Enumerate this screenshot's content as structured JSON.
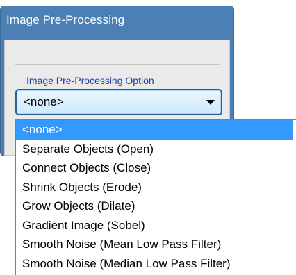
{
  "panel": {
    "title": "Image Pre-Processing"
  },
  "group": {
    "label": "Image Pre-Processing Option"
  },
  "combo": {
    "selected_value": "<none>"
  },
  "dropdown": {
    "items": [
      "<none>",
      "Separate Objects (Open)",
      "Connect Objects (Close)",
      "Shrink Objects (Erode)",
      "Grow Objects (Dilate)",
      "Gradient Image (Sobel)",
      "Smooth Noise (Mean Low Pass Filter)",
      "Smooth Noise (Median Low Pass Filter)"
    ],
    "selected_index": 0
  },
  "colors": {
    "panel_header": "#4c7fb3",
    "panel_body": "#eaeaea",
    "group_label": "#1f3fa0",
    "selection": "#3399ff",
    "combo_border": "#2b6096"
  }
}
